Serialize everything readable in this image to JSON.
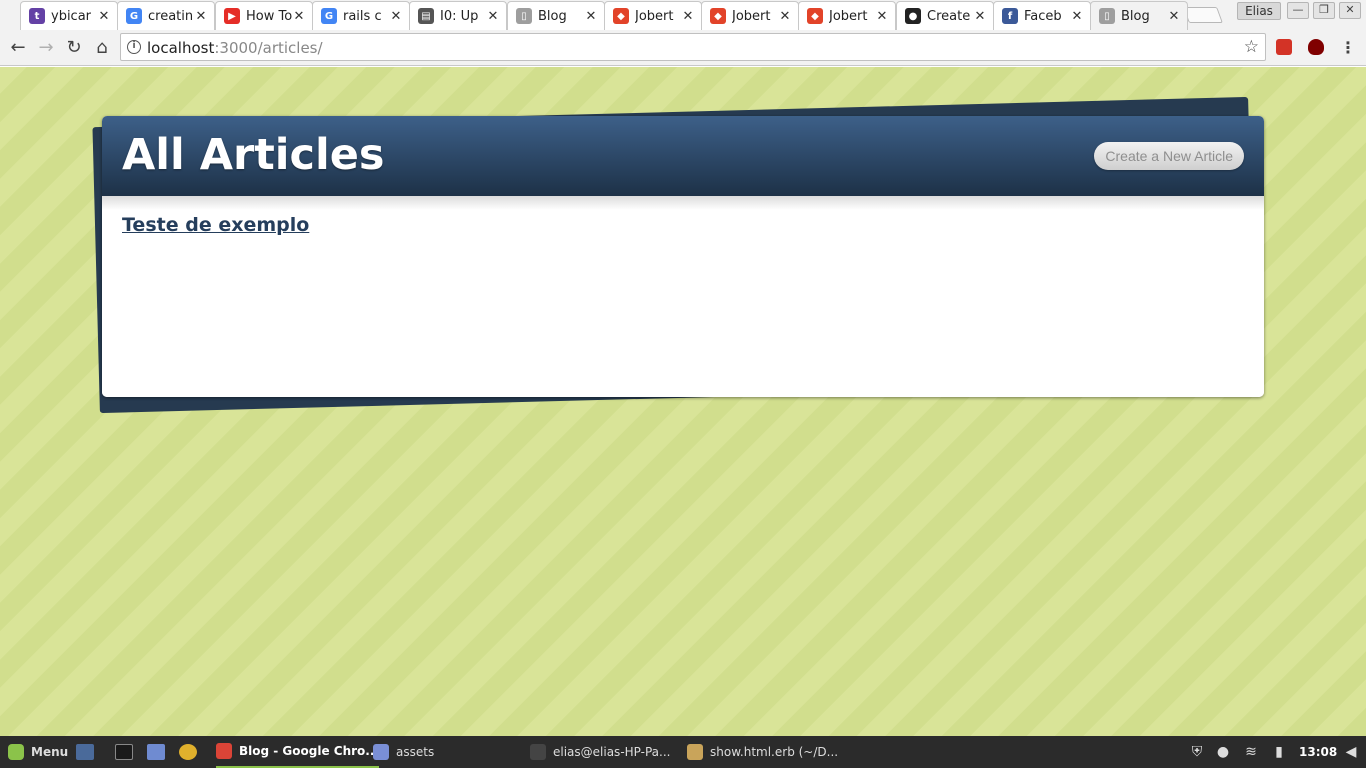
{
  "browser": {
    "tabs": [
      {
        "title": "ybicar",
        "icon": "twitch-icon",
        "color": "#6441a5",
        "glyph": "t"
      },
      {
        "title": "creatin",
        "icon": "google-icon",
        "color": "#4285f4",
        "glyph": "G"
      },
      {
        "title": "How To",
        "icon": "youtube-icon",
        "color": "#e52d27",
        "glyph": "▶"
      },
      {
        "title": "rails c",
        "icon": "google-icon",
        "color": "#4285f4",
        "glyph": "G"
      },
      {
        "title": "I0: Up",
        "icon": "book-icon",
        "color": "#555555",
        "glyph": "▤"
      },
      {
        "title": "Blog",
        "icon": "page-icon",
        "color": "#9e9e9e",
        "glyph": "▯"
      },
      {
        "title": "Jobert",
        "icon": "gitlab-icon",
        "color": "#e24329",
        "glyph": "◆"
      },
      {
        "title": "Jobert",
        "icon": "gitlab-icon",
        "color": "#e24329",
        "glyph": "◆"
      },
      {
        "title": "Jobert",
        "icon": "gitlab-icon",
        "color": "#e24329",
        "glyph": "◆"
      },
      {
        "title": "Create",
        "icon": "github-icon",
        "color": "#222222",
        "glyph": "●"
      },
      {
        "title": "Faceb",
        "icon": "facebook-icon",
        "color": "#3b5998",
        "glyph": "f"
      },
      {
        "title": "Blog",
        "icon": "page-icon",
        "color": "#9e9e9e",
        "glyph": "▯"
      }
    ],
    "active_tab": 11,
    "profile_name": "Elias",
    "url_host": "localhost",
    "url_path": ":3000/articles/"
  },
  "page": {
    "title": "All Articles",
    "new_button": "Create a New Article",
    "articles": [
      "Teste de exemplo"
    ]
  },
  "taskbar": {
    "menu_label": "Menu",
    "windows": [
      {
        "label": "Blog - Google Chro...",
        "icon": "chrome-icon",
        "color": "#db4437"
      },
      {
        "label": "assets",
        "icon": "folder-icon",
        "color": "#7a8fd6"
      },
      {
        "label": "elias@elias-HP-Pa...",
        "icon": "terminal-icon",
        "color": "#444444"
      },
      {
        "label": "show.html.erb (~/D...",
        "icon": "text-editor-icon",
        "color": "#c9a45a"
      }
    ],
    "clock": "13:08"
  }
}
